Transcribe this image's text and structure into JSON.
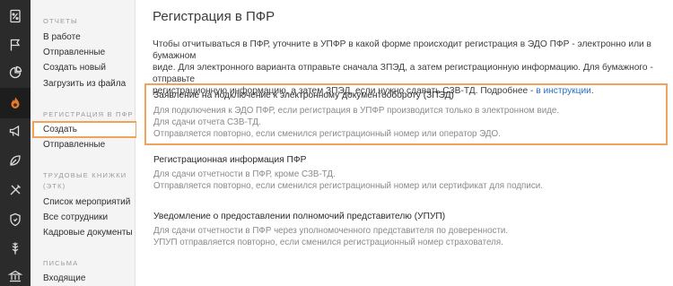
{
  "rail": {
    "icons": [
      {
        "name": "percent-doc-icon"
      },
      {
        "name": "flag-icon"
      },
      {
        "name": "pie-chart-icon"
      },
      {
        "name": "pfr-fire-icon"
      },
      {
        "name": "megaphone-icon"
      },
      {
        "name": "leaf-icon"
      },
      {
        "name": "tools-icon"
      },
      {
        "name": "shield-icon"
      },
      {
        "name": "grain-icon"
      },
      {
        "name": "bank-icon"
      }
    ],
    "active_index": 3
  },
  "submenu": {
    "reports": {
      "title": "ОТЧЕТЫ",
      "items": [
        "В работе",
        "Отправленные",
        "Создать новый",
        "Загрузить из файла"
      ]
    },
    "pfr": {
      "title": "РЕГИСТРАЦИЯ В ПФР",
      "items": [
        "Создать",
        "Отправленные"
      ]
    },
    "labor": {
      "title_line1": "ТРУДОВЫЕ КНИЖКИ",
      "title_line2": "(ЭТК)",
      "items": [
        "Список мероприятий",
        "Все сотрудники",
        "Кадровые документы"
      ]
    },
    "letters": {
      "title": "ПИСЬМА",
      "items": [
        "Входящие"
      ]
    }
  },
  "main": {
    "title": "Регистрация в ПФР",
    "intro_lines": [
      "Чтобы отчитываться в ПФР, уточните в УПФР в какой форме происходит регистрация в ЭДО ПФР - электронно или в бумажном",
      "виде. Для электронного варианта отправьте сначала ЗПЭД, а затем регистрационную информацию. Для бумажного - отправьте",
      "регистрационную информацию, а затем ЗПЭД, если нужно сдавать СЗВ-ТД. Подробнее - "
    ],
    "intro_link": "в инструкции",
    "intro_end": ".",
    "cards": [
      {
        "title": "Заявление на подключение к электронному документообороту (ЗПЭД)",
        "lines": [
          "Для подключения к ЭДО ПФР, если регистрация в УПФР производится только в электронном виде.",
          "Для сдачи отчета СЗВ-ТД.",
          "Отправляется повторно, если сменился регистрационный номер или оператор ЭДО."
        ]
      },
      {
        "title": "Регистрационная информация ПФР",
        "lines": [
          "Для сдачи отчетности в ПФР, кроме СЗВ-ТД.",
          "Отправляется повторно, если сменился регистрационный номер или сертификат для подписи."
        ]
      },
      {
        "title": "Уведомление о предоставлении полномочий представителю (УПУП)",
        "lines": [
          "Для сдачи отчетности в ПФР через уполномоченного представителя по доверенности.",
          "УПУП отправляется повторно, если сменился регистрационный номер страхователя."
        ]
      }
    ]
  },
  "colors": {
    "rail_bg": "#2b2b2b",
    "active_icon": "#e8782a",
    "highlight_border": "#f0a35a",
    "link": "#2a6fc9"
  }
}
